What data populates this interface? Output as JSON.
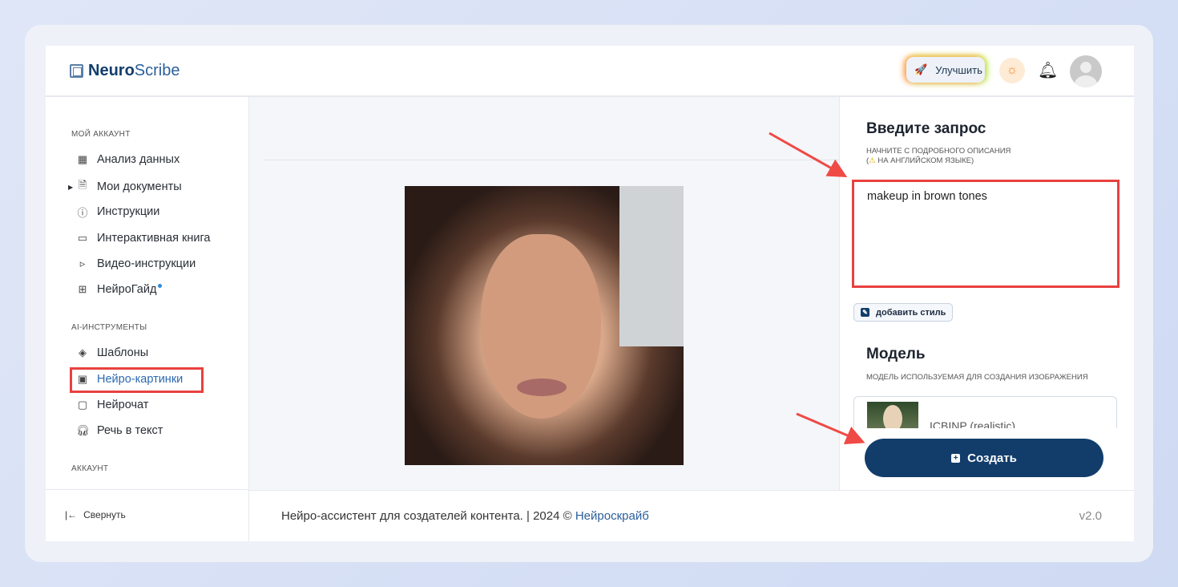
{
  "header": {
    "logo_bold": "Neuro",
    "logo_light": "Scribe",
    "upgrade_label": "Улучшить"
  },
  "sidebar": {
    "section_account": "МОЙ АККАУНТ",
    "account_items": [
      {
        "label": "Анализ данных",
        "icon": "grid-icon"
      },
      {
        "label": "Мои документы",
        "icon": "document-icon"
      },
      {
        "label": "Инструкции",
        "icon": "help-icon"
      },
      {
        "label": "Интерактивная книга",
        "icon": "book-icon"
      },
      {
        "label": "Видео-инструкции",
        "icon": "video-icon"
      },
      {
        "label": "НейроГайд",
        "icon": "layout-icon"
      }
    ],
    "section_tools": "AI-ИНСТРУМЕНТЫ",
    "tool_items": [
      {
        "label": "Шаблоны",
        "icon": "layers-icon"
      },
      {
        "label": "Нейро-картинки",
        "icon": "image-icon",
        "active": true
      },
      {
        "label": "Нейрочат",
        "icon": "chat-icon"
      },
      {
        "label": "Речь в текст",
        "icon": "headphones-icon"
      }
    ],
    "section_acc2": "АККАУНТ",
    "collapse_label": "Свернуть"
  },
  "panel": {
    "title": "Введите запрос",
    "hint1": "НАЧНИТЕ С ПОДРОБНОГО ОПИСАНИЯ",
    "hint2": "НА АНГЛИЙСКОМ ЯЗЫКЕ)",
    "prompt_value": "makeup in brown tones",
    "add_style": "добавить стиль",
    "model_title": "Модель",
    "model_hint": "МОДЕЛЬ ИСПОЛЬЗУЕМАЯ ДЛЯ СОЗДАНИЯ ИЗОБРАЖЕНИЯ",
    "model_name": "ICBINP (realistic)",
    "create": "Создать"
  },
  "footer": {
    "text": "Нейро-ассистент для создателей контента.  | 2024 © ",
    "link": "Нейроскрайб",
    "version": "v2.0"
  },
  "colors": {
    "accent": "#123d6b",
    "highlight": "#e8413f"
  }
}
